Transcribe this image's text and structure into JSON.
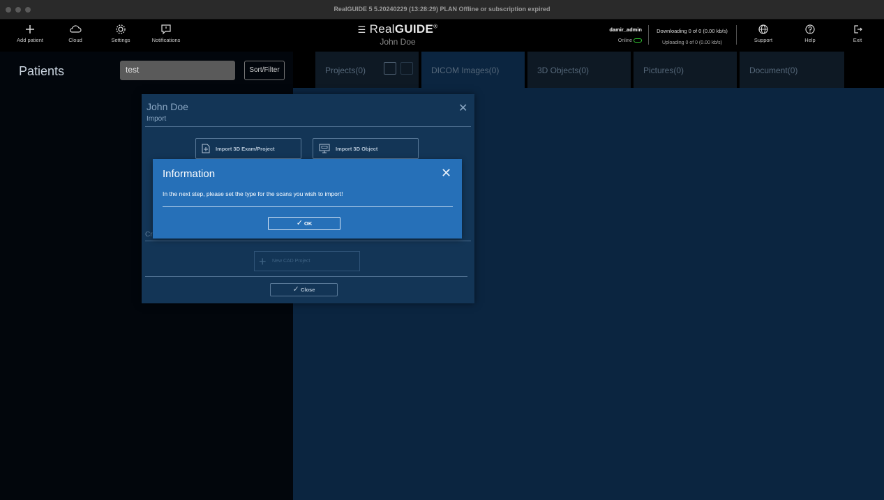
{
  "window": {
    "title": "RealGUIDE 5  5.20240229 (13:28:29)  PLAN Offline or subscription expired"
  },
  "toolbar": {
    "add_patient": "Add patient",
    "cloud": "Cloud",
    "settings": "Settings",
    "notifications": "Notifications",
    "brand_prefix": "Real",
    "brand_bold": "GUIDE",
    "brand_mark": "®",
    "patient_name": "John Doe",
    "username": "damir_admin",
    "online_status": "Online",
    "downloading": "Downloading 0 of 0 (0.00 kb/s)",
    "uploading": "Uploading 0 of 0 (0.00 kb/s)",
    "support": "Support",
    "help": "Help",
    "exit": "Exit"
  },
  "patients": {
    "title": "Patients",
    "search_value": "test",
    "sort_filter": "Sort/Filter"
  },
  "tabs": [
    {
      "label": "Projects(0)"
    },
    {
      "label": "DICOM Images(0)"
    },
    {
      "label": "3D Objects(0)"
    },
    {
      "label": "Pictures(0)"
    },
    {
      "label": "Document(0)"
    }
  ],
  "import_dialog": {
    "title": "John Doe",
    "subtitle": "Import",
    "import_exam": "Import 3D Exam/Project",
    "import_object": "Import 3D Object",
    "create_label": "Cr",
    "new_cad": "New CAD Project",
    "close": "Close"
  },
  "info_modal": {
    "title": "Information",
    "message": "In the next step, please set the type for the scans you wish to import!",
    "ok": "OK"
  },
  "colors": {
    "accent": "#2670b8",
    "dialog": "#133556",
    "main_bg": "#0b2540",
    "online_indicator": "#33cc33"
  }
}
